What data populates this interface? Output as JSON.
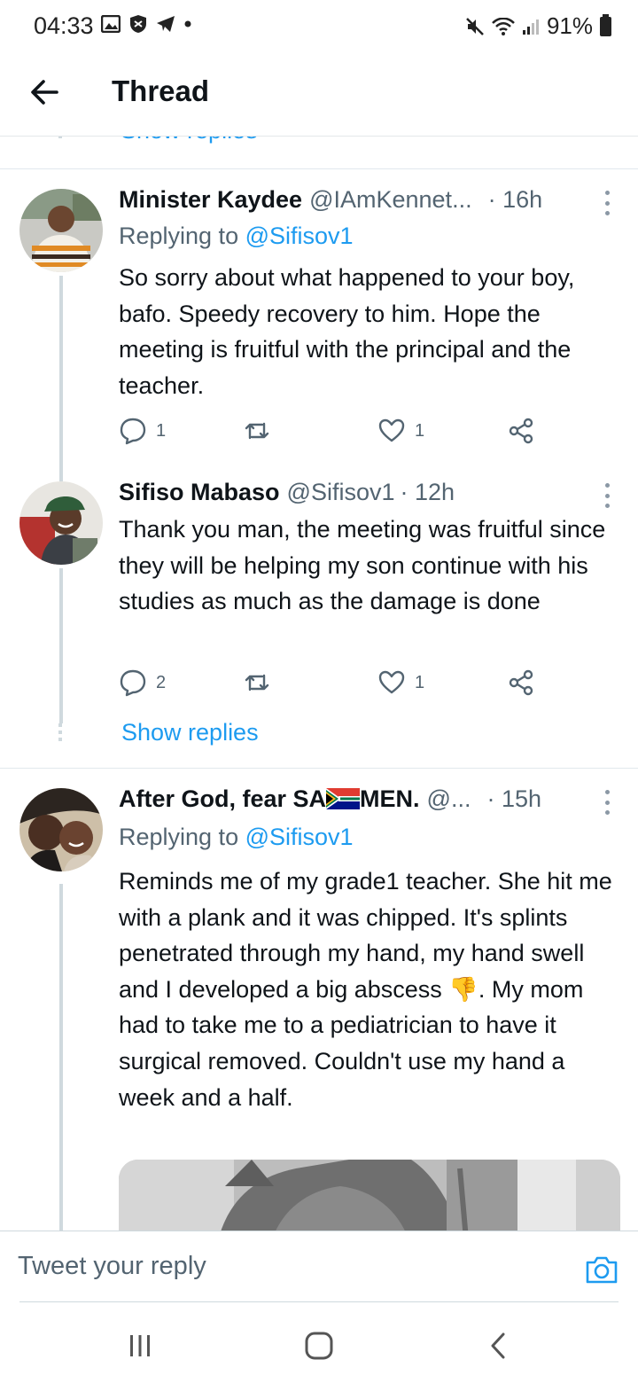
{
  "status_bar": {
    "time": "04:33",
    "battery": "91%"
  },
  "header": {
    "title": "Thread"
  },
  "partial_show_replies": "Show replies",
  "tweets": [
    {
      "name": "Minister Kaydee",
      "handle": "@IAmKennet...",
      "time": "· 16h",
      "replying_prefix": "Replying to",
      "replying_to": "@Sifisov1",
      "text": "So sorry about what happened to your boy, bafo. Speedy recovery to him. Hope the meeting is fruitful with the principal and the teacher.",
      "replies": "1",
      "retweets": "",
      "likes": "1"
    },
    {
      "name": "Sifiso Mabaso",
      "handle": "@Sifisov1",
      "time": "· 12h",
      "text": "Thank you man, the meeting was fruitful since they will be helping my son continue with his studies as much as the damage is done",
      "replies": "2",
      "retweets": "",
      "likes": "1",
      "show_replies": "Show replies"
    },
    {
      "name_part1": "After God, fear SA",
      "name_part2": "MEN.",
      "handle": "@...",
      "time": "· 15h",
      "replying_prefix": "Replying to",
      "replying_to": "@Sifisov1",
      "text_before_emoji": "Reminds me of my grade1 teacher. She hit me with a plank and it was chipped. It's splints penetrated through my hand, my hand swell and I developed a big abscess ",
      "emoji": "👎",
      "text_after_emoji": ". My mom had to take me to a pediatrician to have it surgical removed. Couldn't use my hand a week and a half."
    }
  ],
  "reply_bar": {
    "placeholder": "Tweet your reply"
  },
  "icons": {
    "back": "arrow-left-icon",
    "more": "more-vertical-icon",
    "reply": "speech-bubble-icon",
    "retweet": "retweet-icon",
    "like": "heart-icon",
    "share": "share-icon",
    "camera": "camera-icon",
    "flag": "south-africa-flag-icon"
  },
  "colors": {
    "accent": "#1d9bf0",
    "secondary_text": "#536471",
    "primary_text": "#0f1419"
  }
}
